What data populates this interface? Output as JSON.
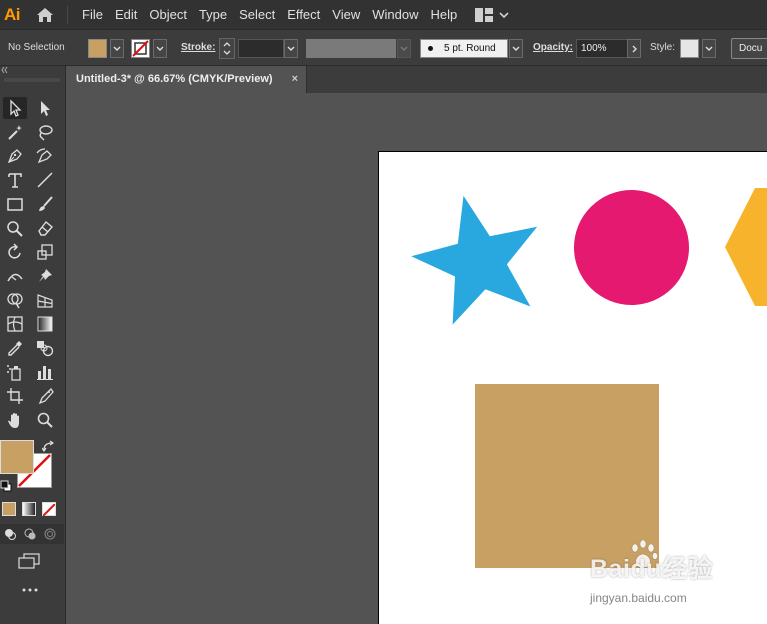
{
  "app": {
    "logo": "Ai"
  },
  "menubar": {
    "items": [
      "File",
      "Edit",
      "Object",
      "Type",
      "Select",
      "Effect",
      "View",
      "Window",
      "Help"
    ]
  },
  "controlbar": {
    "selection_status": "No Selection",
    "stroke_label": "Stroke:",
    "brush_value": "5 pt. Round",
    "opacity_label": "Opacity:",
    "opacity_value": "100%",
    "style_label": "Style:",
    "document_button": "Docu"
  },
  "document": {
    "tab_title": "Untitled-3* @ 66.67% (CMYK/Preview)",
    "close_symbol": "×"
  },
  "colors": {
    "fill": "#c8a064",
    "star": "#29a8e0",
    "circle": "#e5196f",
    "hexagon": "#f7b32b",
    "square": "#c8a064"
  },
  "tools": [
    "selection-tool",
    "direct-selection-tool",
    "magic-wand-tool",
    "lasso-tool",
    "pen-tool",
    "curvature-tool",
    "type-tool",
    "line-segment-tool",
    "rectangle-tool",
    "paintbrush-tool",
    "shaper-tool",
    "eraser-tool",
    "rotate-tool",
    "scale-tool",
    "width-tool",
    "free-transform-tool",
    "shape-builder-tool",
    "perspective-grid-tool",
    "mesh-tool",
    "gradient-tool",
    "eyedropper-tool",
    "blend-tool",
    "symbol-sprayer-tool",
    "column-graph-tool",
    "artboard-tool",
    "slice-tool",
    "hand-tool",
    "zoom-tool"
  ],
  "watermark": {
    "text": "Baidu经验",
    "url": "jingyan.baidu.com"
  }
}
